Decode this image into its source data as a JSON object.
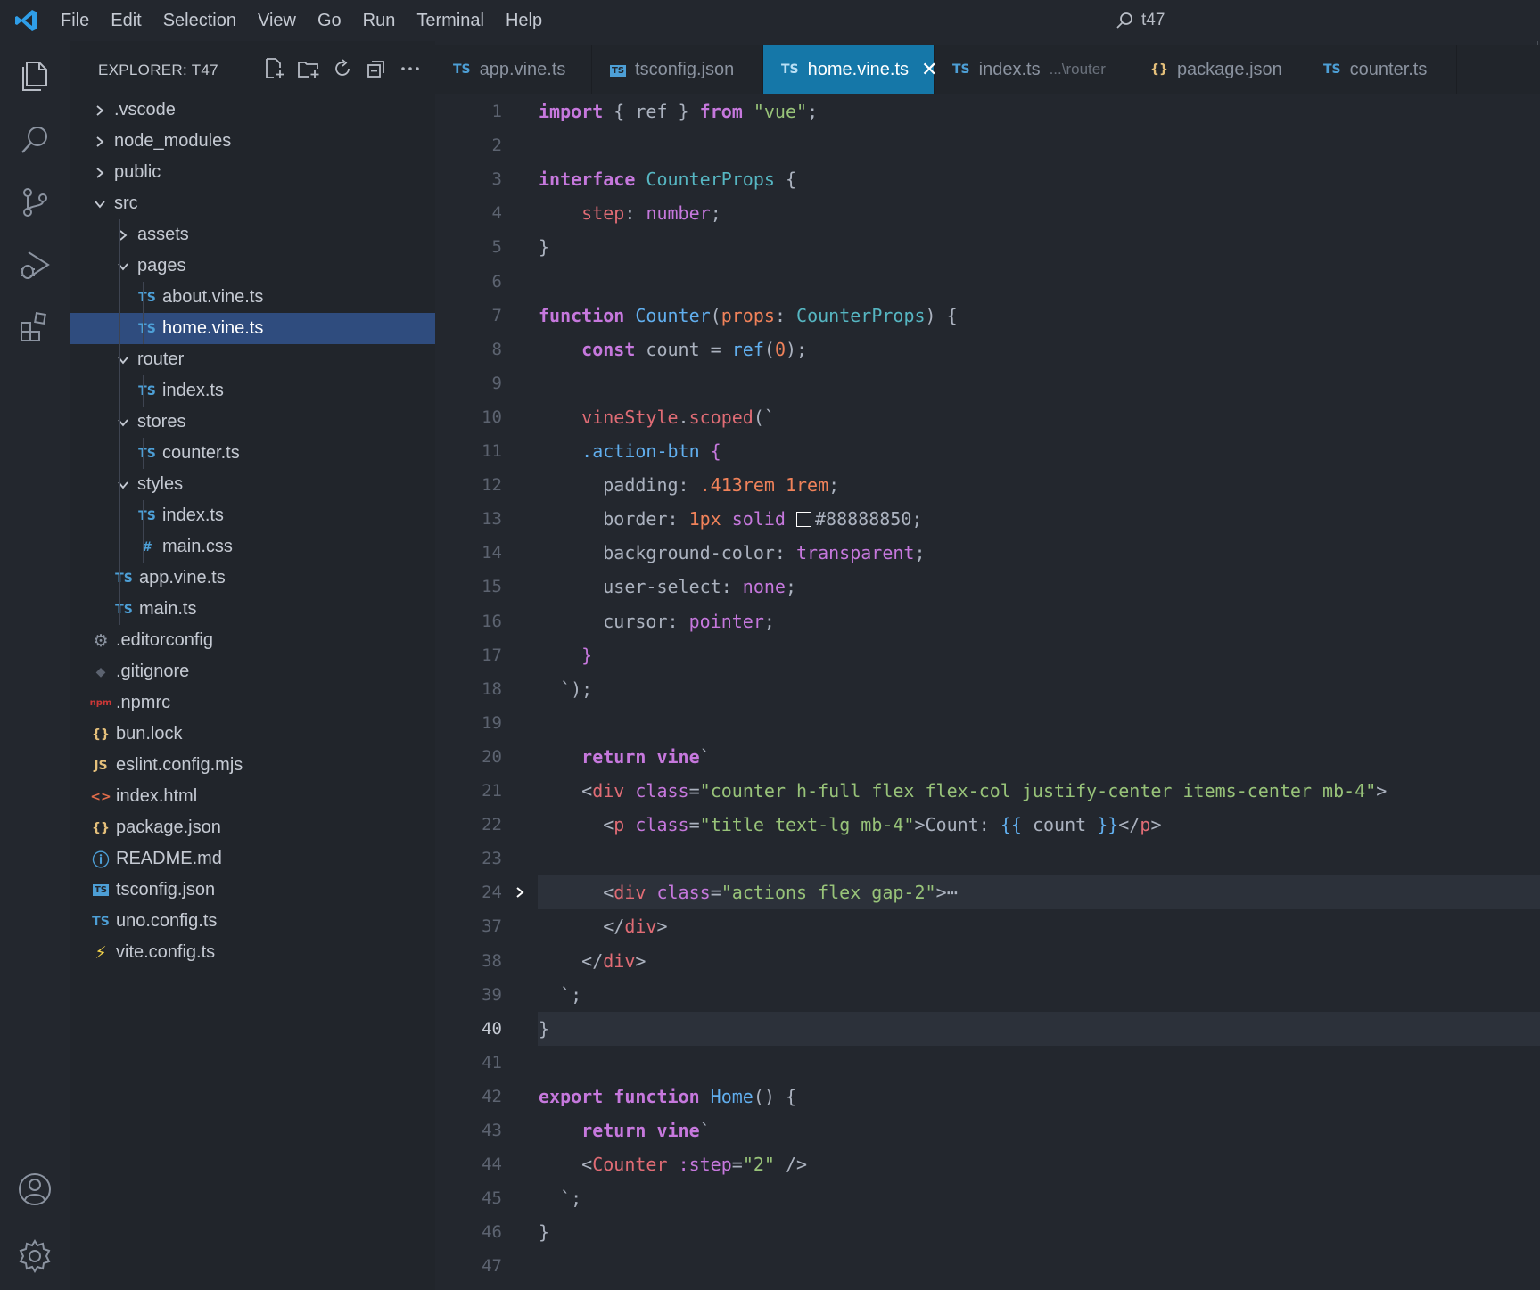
{
  "window": {
    "search_title": "t47"
  },
  "menu": [
    "File",
    "Edit",
    "Selection",
    "View",
    "Go",
    "Run",
    "Terminal",
    "Help"
  ],
  "explorer": {
    "title": "EXPLORER: T47",
    "tree": [
      {
        "label": ".vscode",
        "type": "folder",
        "expanded": false,
        "depth": 0
      },
      {
        "label": "node_modules",
        "type": "folder",
        "expanded": false,
        "depth": 0
      },
      {
        "label": "public",
        "type": "folder",
        "expanded": false,
        "depth": 0
      },
      {
        "label": "src",
        "type": "folder",
        "expanded": true,
        "depth": 0
      },
      {
        "label": "assets",
        "type": "folder",
        "expanded": false,
        "depth": 1
      },
      {
        "label": "pages",
        "type": "folder",
        "expanded": true,
        "depth": 1
      },
      {
        "label": "about.vine.ts",
        "type": "ts",
        "depth": 2
      },
      {
        "label": "home.vine.ts",
        "type": "ts",
        "depth": 2,
        "selected": true
      },
      {
        "label": "router",
        "type": "folder",
        "expanded": true,
        "depth": 1
      },
      {
        "label": "index.ts",
        "type": "ts",
        "depth": 2
      },
      {
        "label": "stores",
        "type": "folder",
        "expanded": true,
        "depth": 1
      },
      {
        "label": "counter.ts",
        "type": "ts",
        "depth": 2
      },
      {
        "label": "styles",
        "type": "folder",
        "expanded": true,
        "depth": 1
      },
      {
        "label": "index.ts",
        "type": "ts",
        "depth": 2
      },
      {
        "label": "main.css",
        "type": "css",
        "depth": 2
      },
      {
        "label": "app.vine.ts",
        "type": "ts",
        "depth": 1
      },
      {
        "label": "main.ts",
        "type": "ts",
        "depth": 1
      },
      {
        "label": ".editorconfig",
        "type": "gear",
        "depth": 0
      },
      {
        "label": ".gitignore",
        "type": "git",
        "depth": 0
      },
      {
        "label": ".npmrc",
        "type": "npm",
        "depth": 0
      },
      {
        "label": "bun.lock",
        "type": "json",
        "depth": 0
      },
      {
        "label": "eslint.config.mjs",
        "type": "js",
        "depth": 0
      },
      {
        "label": "index.html",
        "type": "html",
        "depth": 0
      },
      {
        "label": "package.json",
        "type": "json",
        "depth": 0
      },
      {
        "label": "README.md",
        "type": "info",
        "depth": 0
      },
      {
        "label": "tsconfig.json",
        "type": "tsconfig",
        "depth": 0
      },
      {
        "label": "uno.config.ts",
        "type": "ts",
        "depth": 0
      },
      {
        "label": "vite.config.ts",
        "type": "vite",
        "depth": 0
      }
    ]
  },
  "tabs": [
    {
      "label": "app.vine.ts",
      "icon": "TS",
      "active": false
    },
    {
      "label": "tsconfig.json",
      "icon": "tsconfig",
      "active": false
    },
    {
      "label": "home.vine.ts",
      "icon": "TS",
      "active": true
    },
    {
      "label": "index.ts",
      "icon": "TS",
      "desc": "...\\router",
      "active": false
    },
    {
      "label": "package.json",
      "icon": "{}",
      "active": false
    },
    {
      "label": "counter.ts",
      "icon": "TS",
      "active": false
    }
  ],
  "editor": {
    "current_line": "40",
    "lines": [
      {
        "n": "1",
        "tokens": [
          [
            "k",
            "import"
          ],
          [
            "d",
            " { "
          ],
          [
            "d",
            "ref"
          ],
          [
            "d",
            " } "
          ],
          [
            "k",
            "from"
          ],
          [
            "d",
            " "
          ],
          [
            "s",
            "\"vue\""
          ],
          [
            "d",
            ";"
          ]
        ]
      },
      {
        "n": "2",
        "tokens": []
      },
      {
        "n": "3",
        "tokens": [
          [
            "k",
            "interface"
          ],
          [
            "d",
            " "
          ],
          [
            "t",
            "CounterProps"
          ],
          [
            "d",
            " {"
          ]
        ]
      },
      {
        "n": "4",
        "tokens": [
          [
            "d",
            "    "
          ],
          [
            "p",
            "step"
          ],
          [
            "d",
            ": "
          ],
          [
            "a",
            "number"
          ],
          [
            "d",
            ";"
          ]
        ]
      },
      {
        "n": "5",
        "tokens": [
          [
            "d",
            "}"
          ]
        ]
      },
      {
        "n": "6",
        "tokens": []
      },
      {
        "n": "7",
        "tokens": [
          [
            "k",
            "function"
          ],
          [
            "d",
            " "
          ],
          [
            "f",
            "Counter"
          ],
          [
            "d",
            "("
          ],
          [
            "n",
            "props"
          ],
          [
            "d",
            ": "
          ],
          [
            "t",
            "CounterProps"
          ],
          [
            "d",
            ") {"
          ]
        ]
      },
      {
        "n": "8",
        "tokens": [
          [
            "d",
            "    "
          ],
          [
            "k",
            "const"
          ],
          [
            "d",
            " count = "
          ],
          [
            "f",
            "ref"
          ],
          [
            "d",
            "("
          ],
          [
            "n",
            "0"
          ],
          [
            "d",
            ");"
          ]
        ]
      },
      {
        "n": "9",
        "tokens": []
      },
      {
        "n": "10",
        "tokens": [
          [
            "d",
            "    "
          ],
          [
            "p",
            "vineStyle"
          ],
          [
            "d",
            "."
          ],
          [
            "p",
            "scoped"
          ],
          [
            "d",
            "(`"
          ]
        ]
      },
      {
        "n": "11",
        "tokens": [
          [
            "d",
            "    "
          ],
          [
            "f",
            ".action-btn"
          ],
          [
            "d",
            " "
          ],
          [
            "br",
            "{"
          ]
        ]
      },
      {
        "n": "12",
        "tokens": [
          [
            "d",
            "      padding: "
          ],
          [
            "n",
            ".413rem 1rem"
          ],
          [
            "d",
            ";"
          ]
        ]
      },
      {
        "n": "13",
        "tokens": [
          [
            "d",
            "      border: "
          ],
          [
            "n",
            "1px"
          ],
          [
            "d",
            " "
          ],
          [
            "a",
            "solid"
          ],
          [
            "d",
            " "
          ],
          [
            "swatch",
            ""
          ],
          [
            "d",
            "#88888850;"
          ]
        ]
      },
      {
        "n": "14",
        "tokens": [
          [
            "d",
            "      background-color: "
          ],
          [
            "a",
            "transparent"
          ],
          [
            "d",
            ";"
          ]
        ]
      },
      {
        "n": "15",
        "tokens": [
          [
            "d",
            "      user-select: "
          ],
          [
            "a",
            "none"
          ],
          [
            "d",
            ";"
          ]
        ]
      },
      {
        "n": "16",
        "tokens": [
          [
            "d",
            "      cursor: "
          ],
          [
            "a",
            "pointer"
          ],
          [
            "d",
            ";"
          ]
        ]
      },
      {
        "n": "17",
        "tokens": [
          [
            "d",
            "    "
          ],
          [
            "br",
            "}"
          ]
        ]
      },
      {
        "n": "18",
        "tokens": [
          [
            "d",
            "  `);"
          ]
        ]
      },
      {
        "n": "19",
        "tokens": []
      },
      {
        "n": "20",
        "tokens": [
          [
            "d",
            "    "
          ],
          [
            "k",
            "return"
          ],
          [
            "d",
            " "
          ],
          [
            "k",
            "vine"
          ],
          [
            "d",
            "`"
          ]
        ]
      },
      {
        "n": "21",
        "tokens": [
          [
            "d",
            "    <"
          ],
          [
            "tag",
            "div"
          ],
          [
            "d",
            " "
          ],
          [
            "attr",
            "class"
          ],
          [
            "d",
            "="
          ],
          [
            "s",
            "\"counter h-full flex flex-col justify-center items-center mb-4\""
          ],
          [
            "d",
            ">"
          ]
        ]
      },
      {
        "n": "22",
        "tokens": [
          [
            "d",
            "      <"
          ],
          [
            "tag",
            "p"
          ],
          [
            "d",
            " "
          ],
          [
            "attr",
            "class"
          ],
          [
            "d",
            "="
          ],
          [
            "s",
            "\"title text-lg mb-4\""
          ],
          [
            "d",
            ">Count: "
          ],
          [
            "f",
            "{{"
          ],
          [
            "d",
            " count "
          ],
          [
            "f",
            "}}"
          ],
          [
            "d",
            "</"
          ],
          [
            "tag",
            "p"
          ],
          [
            "d",
            ">"
          ]
        ]
      },
      {
        "n": "23",
        "tokens": []
      },
      {
        "n": "24",
        "fold": true,
        "tokens": [
          [
            "d",
            "      <"
          ],
          [
            "tag",
            "div"
          ],
          [
            "d",
            " "
          ],
          [
            "attr",
            "class"
          ],
          [
            "d",
            "="
          ],
          [
            "s",
            "\"actions flex gap-2\""
          ],
          [
            "d",
            ">"
          ],
          [
            "d",
            "⋯"
          ]
        ]
      },
      {
        "n": "37",
        "tokens": [
          [
            "d",
            "      </"
          ],
          [
            "tag",
            "div"
          ],
          [
            "d",
            ">"
          ]
        ]
      },
      {
        "n": "38",
        "tokens": [
          [
            "d",
            "    </"
          ],
          [
            "tag",
            "div"
          ],
          [
            "d",
            ">"
          ]
        ]
      },
      {
        "n": "39",
        "tokens": [
          [
            "d",
            "  `;"
          ]
        ]
      },
      {
        "n": "40",
        "tokens": [
          [
            "d",
            "}"
          ]
        ]
      },
      {
        "n": "41",
        "tokens": []
      },
      {
        "n": "42",
        "tokens": [
          [
            "k",
            "export"
          ],
          [
            "d",
            " "
          ],
          [
            "k",
            "function"
          ],
          [
            "d",
            " "
          ],
          [
            "f",
            "Home"
          ],
          [
            "d",
            "() {"
          ]
        ]
      },
      {
        "n": "43",
        "tokens": [
          [
            "d",
            "    "
          ],
          [
            "k",
            "return"
          ],
          [
            "d",
            " "
          ],
          [
            "k",
            "vine"
          ],
          [
            "d",
            "`"
          ]
        ]
      },
      {
        "n": "44",
        "tokens": [
          [
            "d",
            "    <"
          ],
          [
            "tag",
            "Counter"
          ],
          [
            "d",
            " "
          ],
          [
            "attr",
            ":step"
          ],
          [
            "d",
            "="
          ],
          [
            "s",
            "\"2\""
          ],
          [
            "d",
            " />"
          ]
        ]
      },
      {
        "n": "45",
        "tokens": [
          [
            "d",
            "  `;"
          ]
        ]
      },
      {
        "n": "46",
        "tokens": [
          [
            "d",
            "}"
          ]
        ]
      },
      {
        "n": "47",
        "tokens": []
      }
    ]
  },
  "colors": {
    "accent": "#1577a8",
    "selection": "#2f4c7e",
    "ts_icon": "#4d9fd6",
    "json_icon": "#e5c07b",
    "npm_icon": "#cb3837"
  }
}
